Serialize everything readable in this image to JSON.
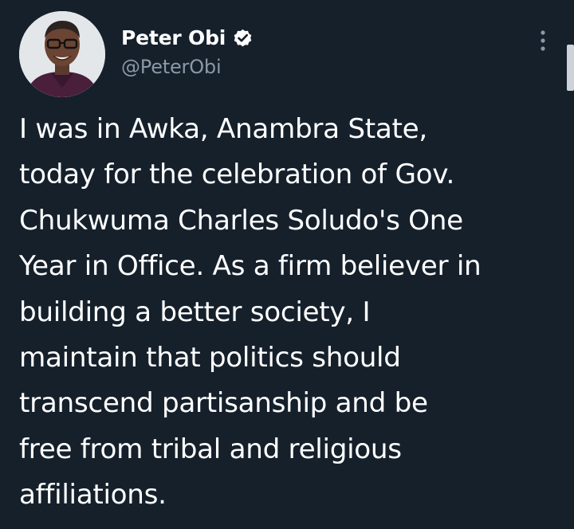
{
  "tweet": {
    "author": {
      "display_name": "Peter Obi",
      "handle": "@PeterObi",
      "verified": true,
      "avatar_icon": "profile-photo"
    },
    "more_icon": "more-vertical-icon",
    "text": "I was in Awka, Anambra State,\ntoday for the celebration of Gov.\nChukwuma Charles Soludo's One\nYear in Office. As a firm believer in\nbuilding a better society, I\nmaintain that politics should\ntranscend partisanship and be\nfree from tribal and religious\naffiliations."
  },
  "colors": {
    "background": "#15202b",
    "text_primary": "#ffffff",
    "text_secondary": "#8b98a5",
    "verified_badge": "#ffffff"
  }
}
